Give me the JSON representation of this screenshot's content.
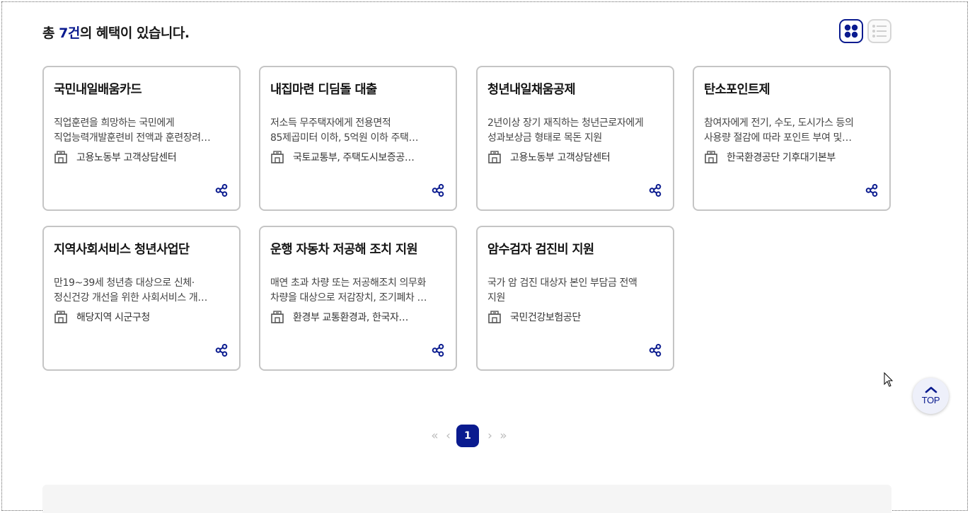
{
  "summary": {
    "prefix": "총 ",
    "count": "7건",
    "suffix": "의 혜택이 있습니다."
  },
  "view_toggle": {
    "grid_icon": "grid-view-icon",
    "list_icon": "list-view-icon",
    "active": "grid"
  },
  "cards": [
    {
      "title": "국민내일배움카드",
      "desc": [
        "직업훈련을 희망하는 국민에게",
        "직업능력개발훈련비 전액과 훈련장려…"
      ],
      "org": "고용노동부 고객상담센터"
    },
    {
      "title": "내집마련 디딤돌 대출",
      "desc": [
        "저소득 무주택자에게 전용면적",
        "85제곱미터 이하, 5억원 이하 주택…"
      ],
      "org": "국토교통부, 주택도시보증공…"
    },
    {
      "title": "청년내일채움공제",
      "desc": [
        "2년이상 장기 재직하는 청년근로자에게",
        "성과보상금 형태로 목돈 지원"
      ],
      "org": "고용노동부 고객상담센터"
    },
    {
      "title": "탄소포인트제",
      "desc": [
        "참여자에게 전기, 수도, 도시가스 등의",
        "사용량 절감에 따라 포인트 부여 및…"
      ],
      "org": "한국환경공단 기후대기본부"
    },
    {
      "title": "지역사회서비스 청년사업단",
      "desc": [
        "만19~39세 청년층 대상으로 신체·",
        "정신건강 개선을 위한 사회서비스 개…"
      ],
      "org": "해당지역 시군구청"
    },
    {
      "title": "운행 자동차 저공해 조치 지원",
      "desc": [
        "매연 초과 차량 또는 저공해조치 의무화",
        "차량을 대상으로 저감장치, 조기폐차 …"
      ],
      "org": "환경부 교통환경과, 한국자…"
    },
    {
      "title": "암수검자 검진비 지원",
      "desc": [
        "국가 암 검진 대상자 본인 부담금 전액",
        "지원"
      ],
      "org": "국민건강보험공단"
    }
  ],
  "pagination": {
    "first": "«",
    "prev": "‹",
    "current": "1",
    "next": "›",
    "last": "»"
  },
  "top_button": {
    "label": "TOP"
  },
  "colors": {
    "accent": "#0a1b8f",
    "border": "#c5c5c5"
  }
}
